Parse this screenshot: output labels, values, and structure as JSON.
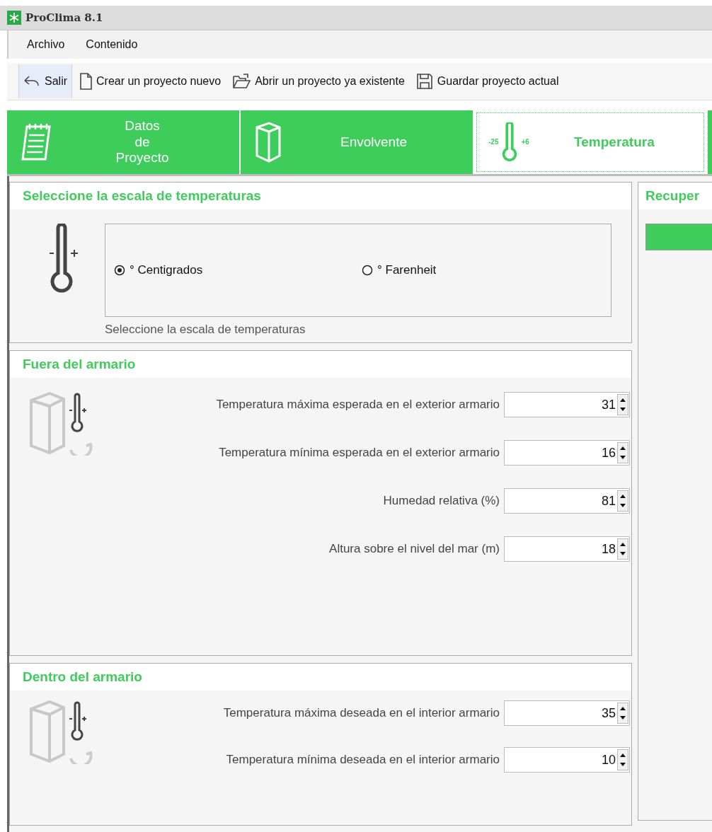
{
  "window": {
    "title": "ProClima 8.1"
  },
  "menu": [
    "Archivo",
    "Contenido"
  ],
  "toolbar": [
    {
      "kind": "exit",
      "label": "Salir",
      "highlighted": true
    },
    {
      "kind": "new",
      "label": "Crear un proyecto nuevo",
      "highlighted": false
    },
    {
      "kind": "open",
      "label": "Abrir un proyecto ya existente",
      "highlighted": false
    },
    {
      "kind": "save",
      "label": "Guardar proyecto actual",
      "highlighted": false
    }
  ],
  "tabs": [
    {
      "kind": "notepad",
      "label": "Datos\nde\nProyecto",
      "selected": false
    },
    {
      "kind": "cabinet",
      "label": "Envolvente",
      "selected": false
    },
    {
      "kind": "thermometer",
      "label": "Temperatura",
      "min_mark": "-25",
      "max_mark": "+6",
      "selected": true
    },
    {
      "kind": "partial",
      "selected": false
    }
  ],
  "scale_panel": {
    "title": "Seleccione la escala de temperaturas",
    "options": [
      {
        "label": "° Centigrados",
        "selected": true
      },
      {
        "label": "° Farenheit",
        "selected": false
      }
    ],
    "caption": "Seleccione la escala de temperaturas"
  },
  "outside_panel": {
    "title": "Fuera del armario",
    "fields": [
      {
        "label": "Temperatura máxima esperada en el exterior armario",
        "value": "31"
      },
      {
        "label": "Temperatura mínima esperada en el exterior armario",
        "value": "16"
      },
      {
        "label": "Humedad relativa (%)",
        "value": "81"
      },
      {
        "label": "Altura sobre el nivel del mar (m)",
        "value": "18"
      }
    ]
  },
  "inside_panel": {
    "title": "Dentro del armario",
    "fields": [
      {
        "label": "Temperatura máxima deseada en el interior armario",
        "value": "35"
      },
      {
        "label": "Temperatura mínima deseada en el interior armario",
        "value": "10"
      }
    ]
  },
  "right_panel": {
    "title": "Recuper"
  }
}
